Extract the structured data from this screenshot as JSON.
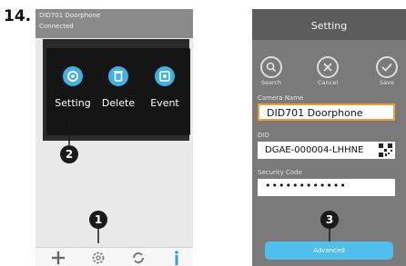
{
  "step_number": "14.",
  "left_phone": {
    "device_name": "DID701 Doorphone",
    "status": "Connected",
    "menu": [
      {
        "label": "Setting",
        "icon": "gear-icon"
      },
      {
        "label": "Delete",
        "icon": "trash-icon"
      },
      {
        "label": "Event",
        "icon": "event-icon"
      }
    ],
    "callouts": {
      "one": "1",
      "two": "2"
    },
    "toolbar_icons": [
      "plus-icon",
      "gear-icon",
      "refresh-icon",
      "info-icon"
    ]
  },
  "right_phone": {
    "title": "Setting",
    "actions": [
      {
        "label": "Search",
        "icon": "search-icon"
      },
      {
        "label": "Cancel",
        "icon": "close-icon"
      },
      {
        "label": "Save",
        "icon": "check-icon"
      }
    ],
    "camera_name_label": "Camera Name",
    "camera_name_value": "DID701 Doorphone",
    "did_label": "DID",
    "did_value": "DGAE-000004-LHHNE",
    "security_code_label": "Security Code",
    "security_code_value": "••••••••••••",
    "callout_three": "3",
    "advanced_label": "Advanced"
  },
  "colors": {
    "accent": "#3fb1e3",
    "focus_border": "#f0a030",
    "button": "#4fc0ec"
  }
}
